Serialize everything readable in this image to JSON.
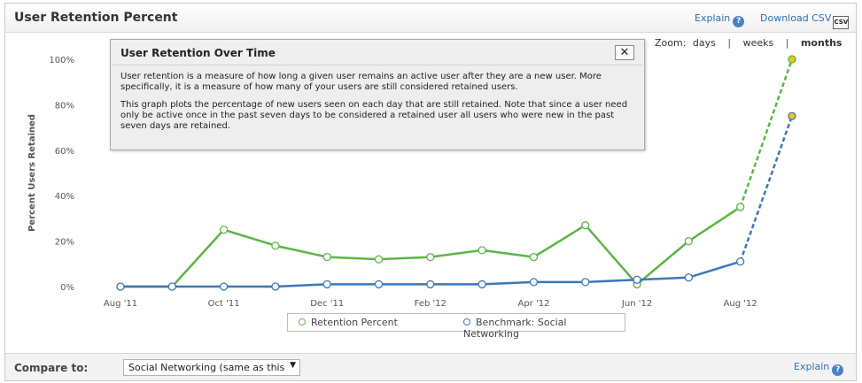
{
  "header": {
    "title": "User Retention Percent",
    "explain_label": "Explain",
    "download_label": "Download CSV",
    "csv_icon_text": "CSV"
  },
  "zoom": {
    "label": "Zoom:",
    "options": [
      "days",
      "weeks",
      "months"
    ],
    "active": "months"
  },
  "popup": {
    "title": "User Retention Over Time",
    "close_label": "✕",
    "paragraph1": "User retention is a measure of how long a given user remains an active user after they are a new user. More specifically, it is a measure of how many of your users are still considered retained users.",
    "paragraph2": "This graph plots the percentage of new users seen on each day that are still retained. Note that since a user need only be active once in the past seven days to be considered a retained user all users who were new in the past seven days are retained."
  },
  "chart_data": {
    "type": "line",
    "ylabel": "Percent Users Retained",
    "xlabel": "",
    "ylim": [
      0,
      100
    ],
    "y_ticks": [
      "0%",
      "20%",
      "40%",
      "60%",
      "80%",
      "100%"
    ],
    "x_tick_labels": [
      "Aug '11",
      "Oct '11",
      "Dec '11",
      "Feb '12",
      "Apr '12",
      "Jun '12",
      "Aug '12"
    ],
    "x": [
      "Aug '11",
      "Sep '11",
      "Oct '11",
      "Nov '11",
      "Dec '11",
      "Jan '12",
      "Feb '12",
      "Mar '12",
      "Apr '12",
      "May '12",
      "Jun '12",
      "Jul '12",
      "Aug '12",
      "Sep '12"
    ],
    "series": [
      {
        "name": "Retention Percent",
        "color": "#5cb544",
        "values": [
          0,
          0,
          25,
          18,
          13,
          12,
          13,
          16,
          13,
          27,
          1,
          20,
          35,
          100
        ],
        "dashed_from_index": 12,
        "final_point_color": "#f0c419"
      },
      {
        "name": "Benchmark: Social Networking",
        "color": "#3c78b5",
        "values": [
          0,
          0,
          0,
          0,
          1,
          1,
          1,
          1,
          2,
          2,
          3,
          4,
          11,
          75
        ],
        "dashed_from_index": 12,
        "final_point_color": "#f0c419"
      }
    ],
    "grid": false,
    "legend_position": "bottom-center"
  },
  "legend": {
    "items": [
      "Retention Percent",
      "Benchmark: Social Networking"
    ]
  },
  "footer": {
    "compare_label": "Compare to:",
    "compare_value": "Social Networking (same as this",
    "explain_label": "Explain"
  },
  "colors": {
    "link": "#2e6fb4",
    "retention": "#5cb544",
    "benchmark": "#3c78b5",
    "projection_point": "#f0c419"
  }
}
